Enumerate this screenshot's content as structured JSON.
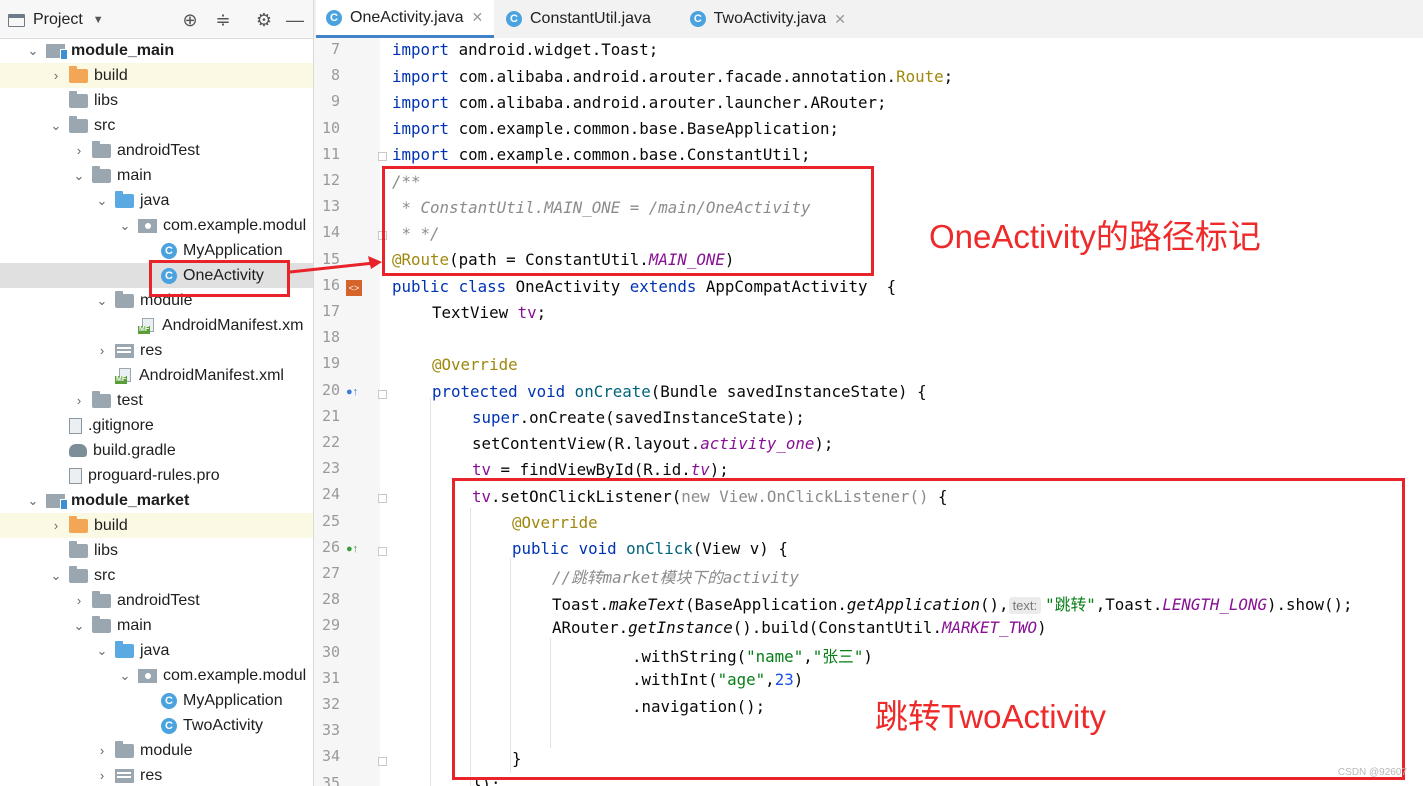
{
  "project_panel": {
    "title": "Project",
    "tree": [
      {
        "label": "module_main",
        "depth": 0,
        "type": "module",
        "expanded": true,
        "bold": true
      },
      {
        "label": "build",
        "depth": 1,
        "type": "folder-orange",
        "expanded": false,
        "highlight": "yellow"
      },
      {
        "label": "libs",
        "depth": 1,
        "type": "folder",
        "leaf": true
      },
      {
        "label": "src",
        "depth": 1,
        "type": "folder",
        "expanded": true
      },
      {
        "label": "androidTest",
        "depth": 2,
        "type": "folder",
        "expanded": false
      },
      {
        "label": "main",
        "depth": 2,
        "type": "folder",
        "expanded": true
      },
      {
        "label": "java",
        "depth": 3,
        "type": "folder-blue",
        "expanded": true
      },
      {
        "label": "com.example.modul",
        "depth": 4,
        "type": "package",
        "expanded": true
      },
      {
        "label": "MyApplication",
        "depth": 5,
        "type": "class",
        "leaf": true
      },
      {
        "label": "OneActivity",
        "depth": 5,
        "type": "class",
        "leaf": true,
        "highlight": "selected"
      },
      {
        "label": "module",
        "depth": 3,
        "type": "folder",
        "expanded": true
      },
      {
        "label": "AndroidManifest.xm",
        "depth": 4,
        "type": "manifest",
        "leaf": true
      },
      {
        "label": "res",
        "depth": 3,
        "type": "res",
        "expanded": false
      },
      {
        "label": "AndroidManifest.xml",
        "depth": 3,
        "type": "manifest",
        "leaf": true
      },
      {
        "label": "test",
        "depth": 2,
        "type": "folder",
        "expanded": false
      },
      {
        "label": ".gitignore",
        "depth": 1,
        "type": "file",
        "leaf": true
      },
      {
        "label": "build.gradle",
        "depth": 1,
        "type": "gradle",
        "leaf": true
      },
      {
        "label": "proguard-rules.pro",
        "depth": 1,
        "type": "file",
        "leaf": true
      },
      {
        "label": "module_market",
        "depth": 0,
        "type": "module",
        "expanded": true,
        "bold": true
      },
      {
        "label": "build",
        "depth": 1,
        "type": "folder-orange",
        "expanded": false,
        "highlight": "yellow"
      },
      {
        "label": "libs",
        "depth": 1,
        "type": "folder",
        "leaf": true
      },
      {
        "label": "src",
        "depth": 1,
        "type": "folder",
        "expanded": true
      },
      {
        "label": "androidTest",
        "depth": 2,
        "type": "folder",
        "expanded": false
      },
      {
        "label": "main",
        "depth": 2,
        "type": "folder",
        "expanded": true
      },
      {
        "label": "java",
        "depth": 3,
        "type": "folder-blue",
        "expanded": true
      },
      {
        "label": "com.example.modul",
        "depth": 4,
        "type": "package",
        "expanded": true
      },
      {
        "label": "MyApplication",
        "depth": 5,
        "type": "class",
        "leaf": true
      },
      {
        "label": "TwoActivity",
        "depth": 5,
        "type": "class",
        "leaf": true
      },
      {
        "label": "module",
        "depth": 3,
        "type": "folder",
        "expanded": false
      },
      {
        "label": "res",
        "depth": 3,
        "type": "res",
        "expanded": false
      }
    ]
  },
  "tabs": [
    {
      "label": "OneActivity.java",
      "active": true
    },
    {
      "label": "ConstantUtil.java",
      "active": false
    },
    {
      "label": "TwoActivity.java",
      "active": false
    }
  ],
  "editor": {
    "line_numbers": [
      "7",
      "8",
      "9",
      "10",
      "11",
      "12",
      "13",
      "14",
      "15",
      "16",
      "17",
      "18",
      "19",
      "20",
      "21",
      "22",
      "23",
      "24",
      "25",
      "26",
      "27",
      "28",
      "29",
      "30",
      "31",
      "32",
      "33",
      "34",
      "35"
    ],
    "tokens": {
      "import": "import",
      "l7": " android.widget.Toast;",
      "l8a": " com.alibaba.android.arouter.facade.annotation.",
      "l8b": "Route",
      "l8c": ";",
      "l9": " com.alibaba.android.arouter.launcher.ARouter;",
      "l10": " com.example.common.base.BaseApplication;",
      "l11": " com.example.common.base.ConstantUtil;",
      "l12": "/**",
      "l13": " * ConstantUtil.MAIN_ONE = /main/OneActivity",
      "l14": " * */",
      "l15a": "@Route",
      "l15b": "(path = ConstantUtil.",
      "l15c": "MAIN_ONE",
      "l15d": ")",
      "public": "public",
      "class": " class",
      "l16a": " OneActivity ",
      "extends": "extends",
      "l16b": " AppCompatActivity  {",
      "l17a": "TextView ",
      "l17b": "tv",
      "l17c": ";",
      "override": "@Override",
      "protected": "protected",
      "void": " void",
      "l20a": " onCreate",
      "l20b": "(Bundle savedInstanceState) {",
      "super": "super",
      "l21": ".onCreate(savedInstanceState);",
      "l22a": "setContentView(R.layout.",
      "l22b": "activity_one",
      "l22c": ");",
      "tv": "tv",
      "l23a": " = findViewById(R.id.",
      "l23b": ");",
      "l24a": ".setOnClickListener(",
      "l24b": "new View.OnClickListener()",
      "l24c": " {",
      "l26a": " onClick",
      "l26b": "(View v) {",
      "l27": "//跳转market模块下的activity",
      "l28a": "Toast.",
      "l28b": "makeText",
      "l28c": "(BaseApplication.",
      "l28d": "getApplication",
      "l28e": "(),",
      "l28hint": "text:",
      "l28f": "\"跳转\"",
      "l28g": ",Toast.",
      "l28h": "LENGTH_LONG",
      "l28i": ").show();",
      "l29a": "ARouter.",
      "l29b": "getInstance",
      "l29c": "().build(ConstantUtil.",
      "l29d": "MARKET_TWO",
      "l29e": ")",
      "l30a": ".withString(",
      "l30b": "\"name\"",
      "l30c": ",",
      "l30d": "\"张三\"",
      "l30e": ")",
      "l31a": ".withInt(",
      "l31b": "\"age\"",
      "l31c": ",",
      "l31d": "23",
      "l31e": ")",
      "l32": ".navigation();",
      "l34": "}",
      "l35": "});"
    }
  },
  "annotations": {
    "route_label": "OneActivity的路径标记",
    "jump_label": "跳转TwoActivity"
  },
  "watermark": "CSDN @92607",
  "colors": {
    "annotation_red": "#e8232a",
    "keyword": "#0033b3",
    "annotation": "#9e880d",
    "string": "#067d17",
    "field": "#871094"
  }
}
